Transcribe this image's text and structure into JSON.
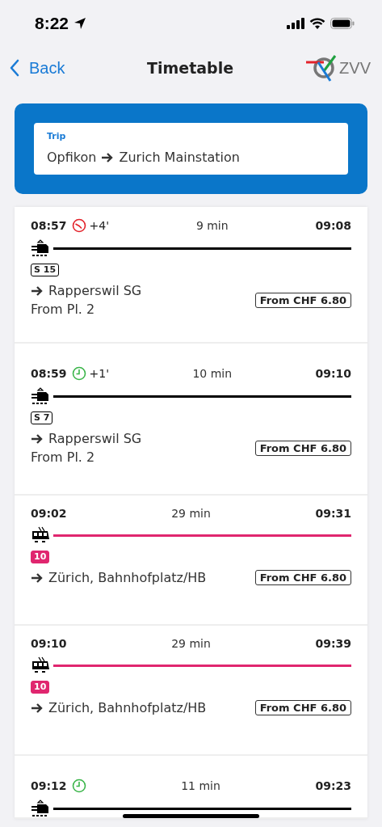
{
  "status_bar": {
    "time": "8:22"
  },
  "nav": {
    "back": "Back",
    "title": "Timetable",
    "logo": "ZVV"
  },
  "trip": {
    "label": "Trip",
    "from": "Opfikon",
    "to": "Zurich Mainstation"
  },
  "connections": [
    {
      "kind": "train",
      "color": "#000000",
      "departure": "08:57",
      "delay": {
        "kind": "late",
        "text": "+4'"
      },
      "duration": "9 min",
      "arrival": "09:08",
      "line": "S 15",
      "destination": "Rapperswil SG",
      "platform": "From Pl. 2",
      "price": "From CHF 6.80"
    },
    {
      "kind": "train",
      "color": "#000000",
      "departure": "08:59",
      "delay": {
        "kind": "ontime",
        "text": "+1'"
      },
      "duration": "10 min",
      "arrival": "09:10",
      "line": "S 7",
      "destination": "Rapperswil SG",
      "platform": "From Pl. 2",
      "price": "From CHF 6.80"
    },
    {
      "kind": "tram",
      "color": "#e0266f",
      "departure": "09:02",
      "duration": "29 min",
      "arrival": "09:31",
      "line": "10",
      "destination": "Zürich, Bahnhofplatz/HB",
      "price": "From CHF 6.80"
    },
    {
      "kind": "tram",
      "color": "#e0266f",
      "departure": "09:10",
      "duration": "29 min",
      "arrival": "09:39",
      "line": "10",
      "destination": "Zürich, Bahnhofplatz/HB",
      "price": "From CHF 6.80"
    },
    {
      "kind": "train",
      "color": "#000000",
      "departure": "09:12",
      "delay": {
        "kind": "ontime"
      },
      "duration": "11 min",
      "arrival": "09:23"
    }
  ]
}
